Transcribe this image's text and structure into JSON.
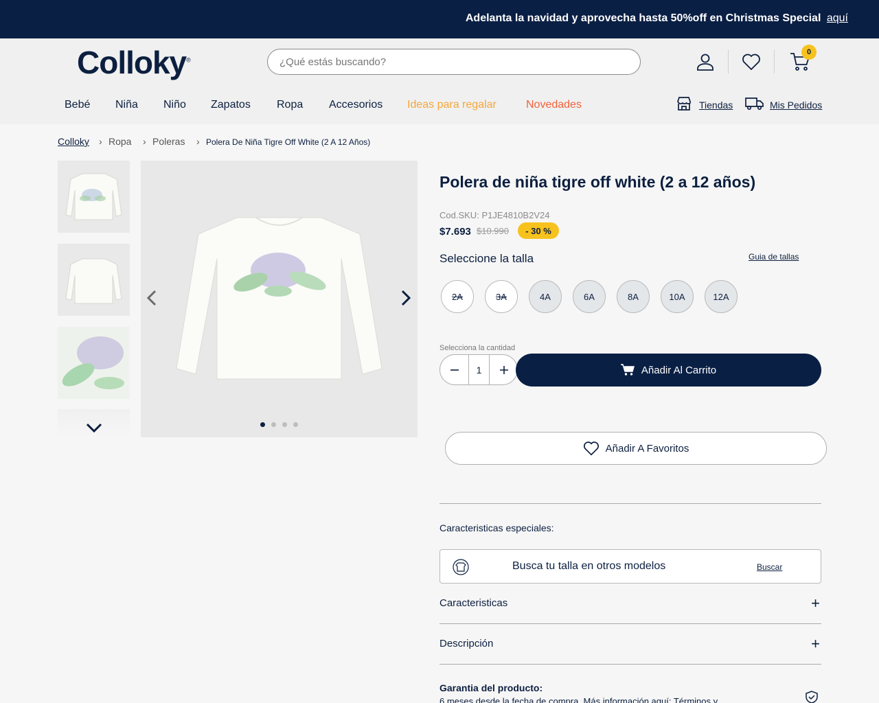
{
  "promo": {
    "text": "Adelanta la navidad y aprovecha hasta 50%off en Christmas Special",
    "link": "aquí"
  },
  "header": {
    "logo": "Colloky",
    "search_placeholder": "¿Qué estás buscando?",
    "cart_count": "0"
  },
  "nav": {
    "items": [
      "Bebé",
      "Niña",
      "Niño",
      "Zapatos",
      "Ropa",
      "Accesorios",
      "Ideas para regalar",
      "Novedades"
    ],
    "stores": "Tiendas",
    "orders": "Mis Pedidos"
  },
  "breadcrumb": [
    "Colloky",
    "Ropa",
    "Poleras",
    "Polera De Niña Tigre Off White (2 A 12 Años)"
  ],
  "gallery": {
    "thumb_count": 4,
    "active_image": 1,
    "total_images": 4
  },
  "product": {
    "title": "Polera de niña tigre off white (2 a 12 años)",
    "sku_label": "Cod.SKU:",
    "sku": "P1JE4810B2V24",
    "price": "$7.693",
    "old_price": "$10.990",
    "discount": "-  30 %",
    "size_label": "Seleccione la talla",
    "size_guide": "Guia de tallas",
    "sizes": [
      {
        "label": "2A",
        "available": false
      },
      {
        "label": "3A",
        "available": false
      },
      {
        "label": "4A",
        "available": true
      },
      {
        "label": "6A",
        "available": true
      },
      {
        "label": "8A",
        "available": true
      },
      {
        "label": "10A",
        "available": true
      },
      {
        "label": "12A",
        "available": true
      }
    ],
    "qty_label": "Selecciona la cantidad",
    "qty": "1",
    "add_to_cart": "Añadir Al Carrito",
    "add_to_fav": "Añadir A Favoritos",
    "special_label": "Caracteristicas especiales:",
    "size_search_text": "Busca tu talla en otros modelos",
    "size_search_link": "Buscar",
    "accordion_1": "Caracteristicas",
    "accordion_2": "Descripción",
    "warranty_title": "Garantia del producto:",
    "warranty_text": "6 meses desde la fecha de compra. Más información aquí: Términos y"
  },
  "colors": {
    "navy": "#0a1f44",
    "yellow": "#f7c21e",
    "gift": "#f4a63a",
    "new": "#f0623b"
  }
}
